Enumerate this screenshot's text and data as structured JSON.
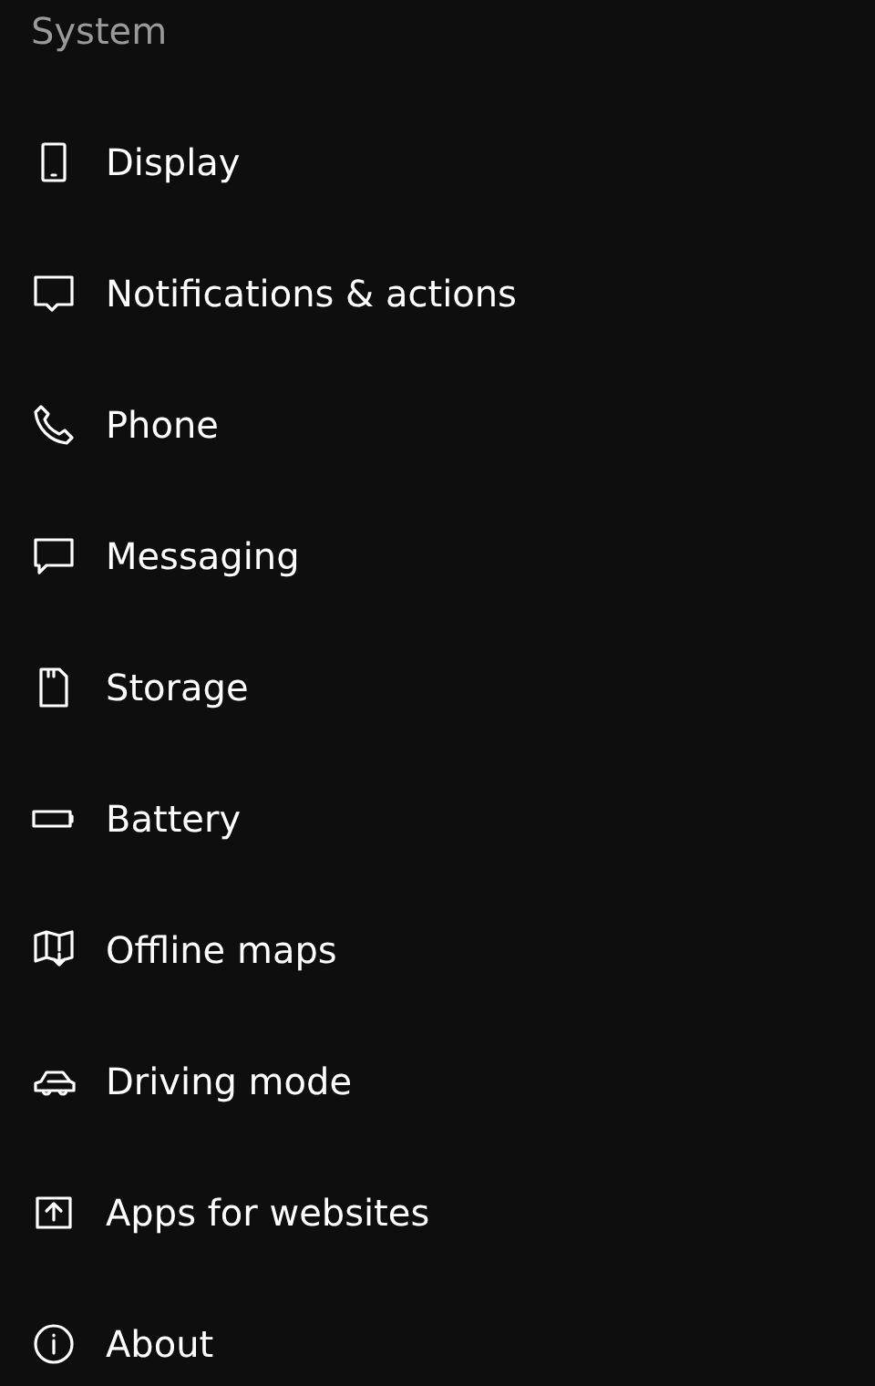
{
  "title": "System",
  "items": [
    {
      "label": "Display"
    },
    {
      "label": "Notifications & actions"
    },
    {
      "label": "Phone"
    },
    {
      "label": "Messaging"
    },
    {
      "label": "Storage"
    },
    {
      "label": "Battery"
    },
    {
      "label": "Offline maps"
    },
    {
      "label": "Driving mode"
    },
    {
      "label": "Apps for websites"
    },
    {
      "label": "About"
    }
  ]
}
